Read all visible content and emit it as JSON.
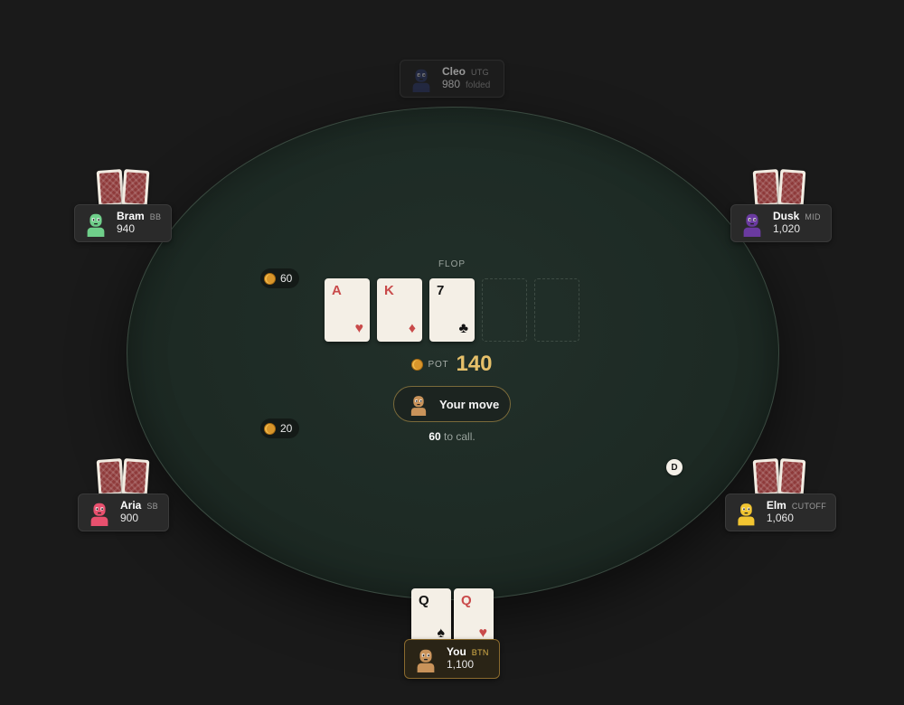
{
  "players": {
    "cleo": {
      "name": "Cleo",
      "position": "UTG",
      "stack": "980",
      "status": "folded",
      "avatar_color": "#2b3560"
    },
    "bram": {
      "name": "Bram",
      "position": "BB",
      "stack": "940",
      "avatar_color": "#6fcf8a"
    },
    "dusk": {
      "name": "Dusk",
      "position": "MID",
      "stack": "1,020",
      "avatar_color": "#6a3aa0"
    },
    "aria": {
      "name": "Aria",
      "position": "SB",
      "stack": "900",
      "avatar_color": "#e8506e"
    },
    "elm": {
      "name": "Elm",
      "position": "CUTOFF",
      "stack": "1,060",
      "avatar_color": "#f2c531"
    },
    "you": {
      "name": "You",
      "position": "BTN",
      "stack": "1,100",
      "avatar_color": "#c9935a"
    }
  },
  "board": {
    "street": "FLOP",
    "cards": [
      {
        "rank": "A",
        "suit": "♥",
        "color": "red"
      },
      {
        "rank": "K",
        "suit": "♦",
        "color": "red"
      },
      {
        "rank": "7",
        "suit": "♣",
        "color": "black"
      }
    ]
  },
  "hero_cards": [
    {
      "rank": "Q",
      "suit": "♠",
      "color": "black"
    },
    {
      "rank": "Q",
      "suit": "♥",
      "color": "red"
    }
  ],
  "bets": {
    "bram": "60",
    "aria": "20"
  },
  "pot": {
    "label": "POT",
    "amount": "140"
  },
  "turn": {
    "text": "Your move"
  },
  "call": {
    "amount": "60",
    "suffix": " to call."
  },
  "dealer_button": {
    "label": "D"
  },
  "colors": {
    "table_felt": "#1d2a24",
    "pot_gold": "#e6c06a",
    "card_back": "#8e3a3a"
  }
}
